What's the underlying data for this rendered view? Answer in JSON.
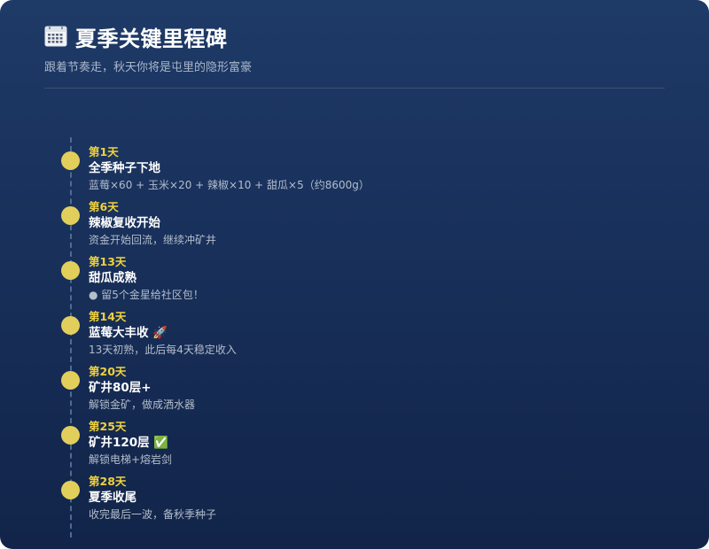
{
  "header": {
    "icon": "calendar-icon",
    "title": "夏季关键里程碑",
    "subtitle": "跟着节奏走，秋天你将是屯里的隐形富豪"
  },
  "colors": {
    "background_top": "#1e3a67",
    "background_bottom": "#122449",
    "accent_yellow": "#efd13c",
    "dot_color": "#e2cf5b",
    "title_text": "#ffffff",
    "muted_text": "#b3bdcc"
  },
  "milestones": [
    {
      "day": "第1天",
      "title": "全季种子下地",
      "desc": "蓝莓×60 + 玉米×20 + 辣椒×10 + 甜瓜×5（约8600g）"
    },
    {
      "day": "第6天",
      "title": "辣椒复收开始",
      "desc": "资金开始回流，继续冲矿井"
    },
    {
      "day": "第13天",
      "title": "甜瓜成熟",
      "desc": "● 留5个金星给社区包！"
    },
    {
      "day": "第14天",
      "title": "蓝莓大丰收 🚀",
      "desc": "13天初熟，此后每4天稳定收入"
    },
    {
      "day": "第20天",
      "title": "矿井80层+",
      "desc": "解锁金矿，做成洒水器"
    },
    {
      "day": "第25天",
      "title": "矿井120层 ✅",
      "desc": "解锁电梯+熔岩剑"
    },
    {
      "day": "第28天",
      "title": "夏季收尾",
      "desc": "收完最后一波，备秋季种子"
    }
  ]
}
